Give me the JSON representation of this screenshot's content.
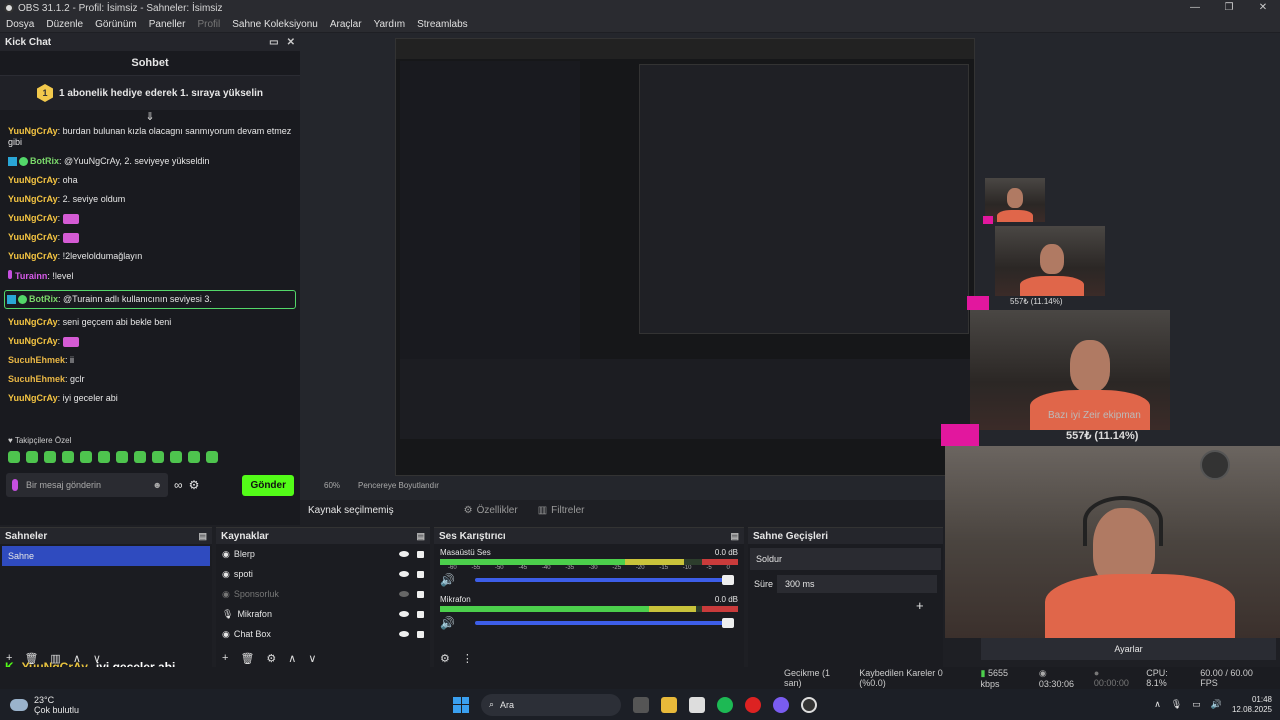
{
  "window": {
    "title": "OBS 31.1.2 - Profil: İsimsiz - Sahneler: İsimsiz"
  },
  "menu": [
    "Dosya",
    "Düzenle",
    "Görünüm",
    "Paneller",
    "Profil",
    "Sahne Koleksiyonu",
    "Araçlar",
    "Yardım",
    "Streamlabs"
  ],
  "kick": {
    "dock_title": "Kick Chat",
    "chat_title": "Sohbet",
    "promo_rank": "1",
    "promo_text": "1 abonelik hediye ederek 1. sıraya yükselin",
    "messages": [
      {
        "user": "YuuNgCrAy",
        "text": ": burdan bulunan kızla olacagnı sanmıyorum devam etmez gibi"
      },
      {
        "user": "BotRix",
        "text": ": @YuuNgCrAy, 2. seviyeye yükseldin"
      },
      {
        "user": "YuuNgCrAy",
        "text": ": oha"
      },
      {
        "user": "YuuNgCrAy",
        "text": ": 2. seviye oldum"
      },
      {
        "user": "YuuNgCrAy",
        "text": ":"
      },
      {
        "user": "YuuNgCrAy",
        "text": ":"
      },
      {
        "user": "YuuNgCrAy",
        "text": ": !2leveloldumağlayın"
      },
      {
        "user": "Turainn",
        "text": ": !level"
      },
      {
        "user": "BotRix",
        "text": ": @Turainn adlı kullanıcının seviyesi 3."
      },
      {
        "user": "YuuNgCrAy",
        "text": ": seni geçcem abi bekle beni"
      },
      {
        "user": "YuuNgCrAy",
        "text": ":"
      },
      {
        "user": "SucuhEhmek",
        "text": ": ii"
      },
      {
        "user": "SucuhEhmek",
        "text": ": gclr"
      },
      {
        "user": "YuuNgCrAy",
        "text": ": iyi geceler abi"
      }
    ],
    "followers_label": "Takipçilere Özel",
    "input_placeholder": "Bir mesaj gönderin",
    "send_label": "Gönder"
  },
  "preview": {
    "zoom": "60%",
    "zoom_mode": "Pencereye Boyutlandır",
    "no_source": "Kaynak seçilmemiş",
    "properties": "Özellikler",
    "filters": "Filtreler",
    "webcam_caption": "Bazı iyi Zeir ekipman",
    "webcam_amount": "557₺ (11.14%)",
    "webcam_amount_small": "557₺ (11.14%)"
  },
  "scenes": {
    "title": "Sahneler",
    "items": [
      "Sahne"
    ]
  },
  "sources": {
    "title": "Kaynaklar",
    "items": [
      "Blerp",
      "spoti",
      "Sponsorluk",
      "Mikrafon",
      "Chat Box"
    ]
  },
  "mixer": {
    "title": "Ses Karıştırıcı",
    "channels": [
      {
        "name": "Masaüstü Ses",
        "db": "0.0 dB"
      },
      {
        "name": "Mikrafon",
        "db": "0.0 dB"
      }
    ],
    "ticks": [
      "-60",
      "-55",
      "-50",
      "-45",
      "-40",
      "-35",
      "-30",
      "-25",
      "-20",
      "-15",
      "-10",
      "-5",
      "0"
    ]
  },
  "transitions": {
    "title": "Sahne Geçişleri",
    "type": "Soldur",
    "duration_label": "Süre",
    "duration": "300 ms"
  },
  "controls": {
    "settings": "Ayarlar"
  },
  "ticker": {
    "user": "YuuNgCrAy",
    "text": "iyi geceler abi"
  },
  "status": {
    "delay": "Gecikme (1 san)",
    "dropped": "Kaybedilen Kareler 0 (%0.0)",
    "bitrate": "5655 kbps",
    "live_time": "03:30:06",
    "rec_time": "00:00:00",
    "cpu": "CPU: 8.1%",
    "fps": "60.00 / 60.00 FPS"
  },
  "taskbar": {
    "temp": "23°C",
    "weather": "Çok bulutlu",
    "search": "Ara",
    "time": "01:48",
    "date": "12.08.2025"
  }
}
